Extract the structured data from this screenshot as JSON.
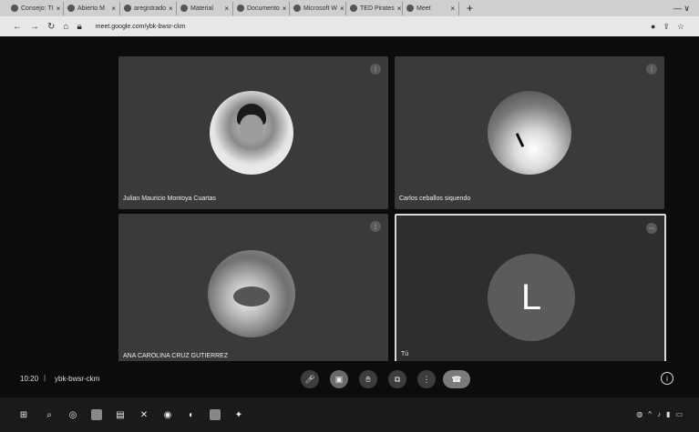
{
  "browser": {
    "tabs": [
      {
        "title": "Consejo: TI"
      },
      {
        "title": "Abierto M"
      },
      {
        "title": "aregistrado"
      },
      {
        "title": "Material"
      },
      {
        "title": "Documento"
      },
      {
        "title": "Microsoft W"
      },
      {
        "title": "TED Pirates"
      },
      {
        "title": "Meet"
      }
    ],
    "new_tab": "+",
    "url": "meet.google.com/ybk-bwsr-ckm",
    "window_controls": "— ∨"
  },
  "meet": {
    "participants": [
      {
        "name": "Julian Mauricio Montoya Cuartas",
        "indicator": "⋮",
        "initial": ""
      },
      {
        "name": "Carlos ceballos siquendo",
        "indicator": "⋮",
        "initial": ""
      },
      {
        "name": "ANA CAROLINA CRUZ GUTIERREZ",
        "indicator": "⋮",
        "initial": ""
      },
      {
        "name": "Tú",
        "indicator": "⋯",
        "initial": "L"
      }
    ]
  },
  "controls": {
    "time": "10:20",
    "separator": "|",
    "meeting_code": "ybk-bwsr-ckm"
  },
  "colors": {
    "meet_bg": "#0c0c0c",
    "tile_bg": "#3a3a3a",
    "active_border": "#d8d8d8"
  }
}
